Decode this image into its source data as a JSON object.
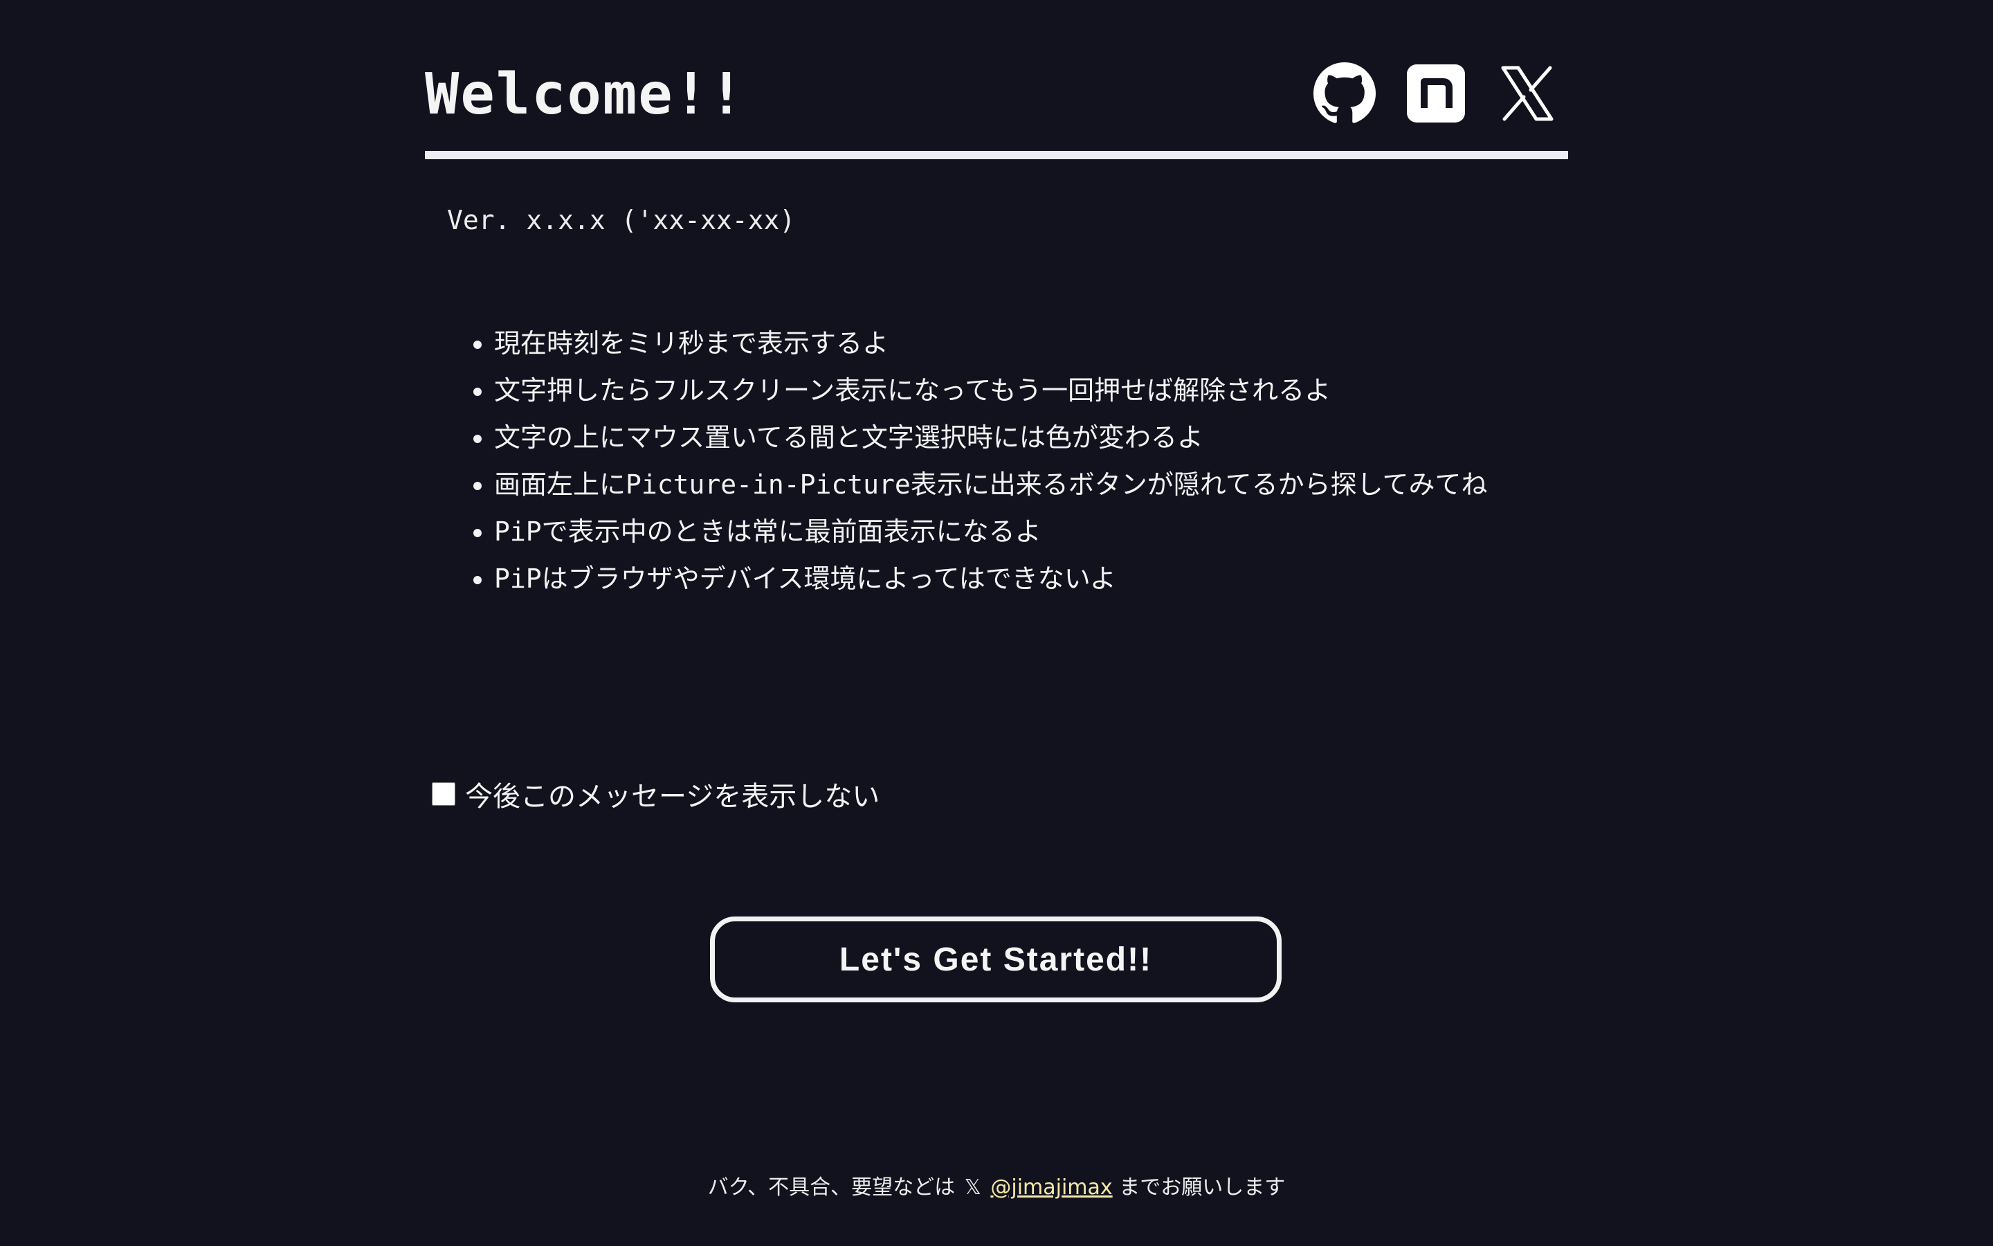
{
  "header": {
    "title": "Welcome!!",
    "social_links": [
      {
        "icon": "github-icon"
      },
      {
        "icon": "note-icon"
      },
      {
        "icon": "x-icon"
      }
    ]
  },
  "version": "Ver. x.x.x ('xx-xx-xx)",
  "features": [
    "現在時刻をミリ秒まで表示するよ",
    "文字押したらフルスクリーン表示になってもう一回押せば解除されるよ",
    "文字の上にマウス置いてる間と文字選択時には色が変わるよ",
    "画面左上にPicture-in-Picture表示に出来るボタンが隠れてるから探してみてね",
    "PiPで表示中のときは常に最前面表示になるよ",
    "PiPはブラウザやデバイス環境によってはできないよ"
  ],
  "optout": {
    "label": "今後このメッセージを表示しない",
    "checked": false
  },
  "start_button": "Let's Get Started!!",
  "footer": {
    "prefix": "バク、不具合、要望などは",
    "x_glyph": "𝕏",
    "handle": "@jimajimax",
    "suffix": "までお願いします"
  },
  "colors": {
    "background": "#12121f",
    "text": "#f2f2f2",
    "link": "#f5e9a8"
  }
}
